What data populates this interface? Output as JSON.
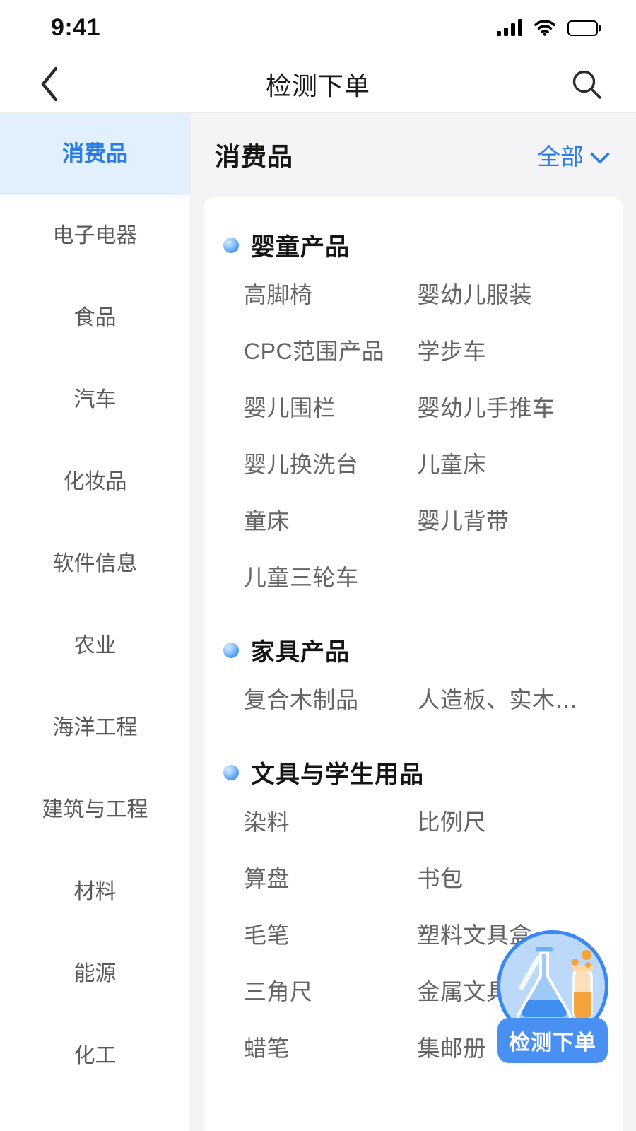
{
  "status_bar": {
    "time": "9:41",
    "icons": [
      "signal-icon",
      "wifi-icon",
      "battery-icon"
    ]
  },
  "nav_bar": {
    "back_icon": "chevron-left-icon",
    "title": "检测下单",
    "search_icon": "search-icon"
  },
  "sidebar": {
    "items": [
      {
        "label": "消费品",
        "active": true
      },
      {
        "label": "电子电器",
        "active": false
      },
      {
        "label": "食品",
        "active": false
      },
      {
        "label": "汽车",
        "active": false
      },
      {
        "label": "化妆品",
        "active": false
      },
      {
        "label": "软件信息",
        "active": false
      },
      {
        "label": "农业",
        "active": false
      },
      {
        "label": "海洋工程",
        "active": false
      },
      {
        "label": "建筑与工程",
        "active": false
      },
      {
        "label": "材料",
        "active": false
      },
      {
        "label": "能源",
        "active": false
      },
      {
        "label": "化工",
        "active": false
      }
    ]
  },
  "content": {
    "title": "消费品",
    "filter": {
      "label": "全部",
      "icon": "chevron-down-icon"
    },
    "groups": [
      {
        "title": "婴童产品",
        "items": [
          "高脚椅",
          "婴幼儿服装",
          "CPC范围产品",
          "学步车",
          "婴儿围栏",
          "婴幼儿手推车",
          "婴儿换洗台",
          "儿童床",
          "童床",
          "婴儿背带",
          "儿童三轮车",
          ""
        ]
      },
      {
        "title": "家具产品",
        "items": [
          "复合木制品",
          "人造板、实木…"
        ]
      },
      {
        "title": "文具与学生用品",
        "items": [
          "染料",
          "比例尺",
          "算盘",
          "书包",
          "毛笔",
          "塑料文具盒",
          "三角尺",
          "金属文具盒",
          "蜡笔",
          "集邮册"
        ]
      }
    ]
  },
  "fab": {
    "label": "检测下单",
    "icon": "lab-flask-icon"
  },
  "colors": {
    "accent": "#2b7ce5",
    "accent_bg": "#e2effc",
    "page_bg": "#f4f4f6",
    "card_bg": "#ffffff",
    "text_primary": "#161616",
    "text_secondary": "#646464",
    "fab_blue": "#4a90f2",
    "fab_circle_bg": "#bcd9f9",
    "flask_blue": "#3f8ef0",
    "tube_orange": "#f5a33c"
  }
}
